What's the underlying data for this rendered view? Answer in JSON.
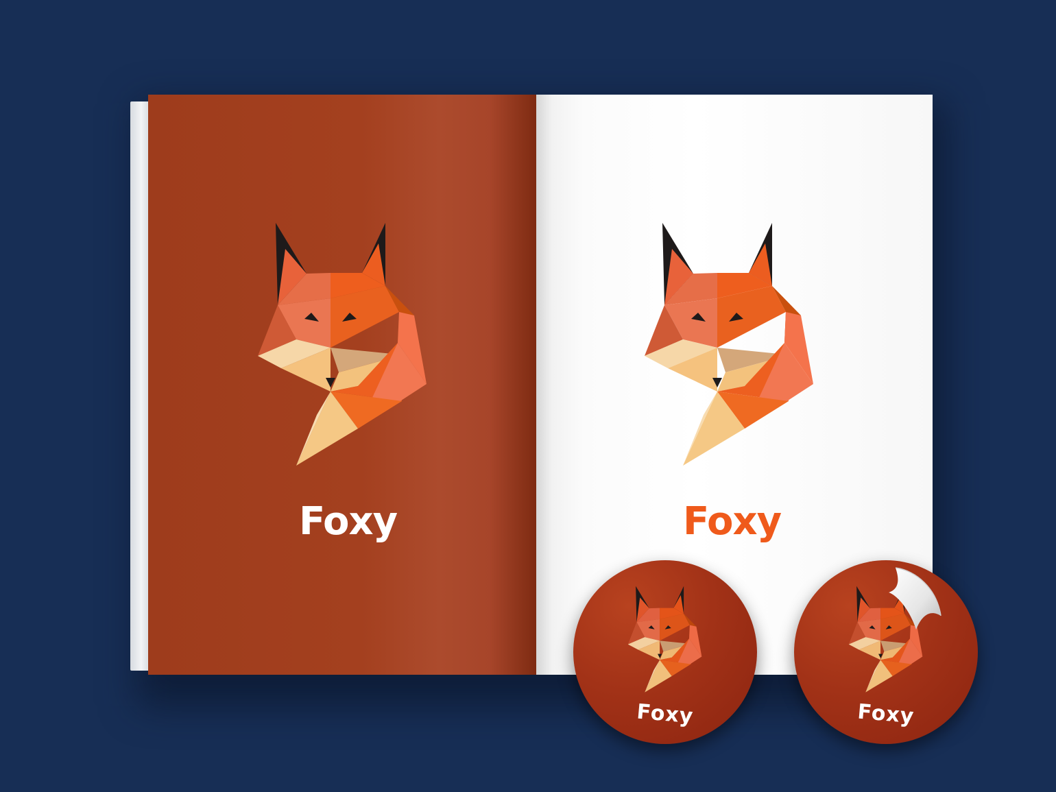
{
  "brand": {
    "name": "Foxy",
    "colors": {
      "background": "#172e55",
      "cover": "#a4401f",
      "accent": "#ef5a1b",
      "paper": "#ffffff"
    }
  },
  "book": {
    "left_page": {
      "wordmark": "Foxy",
      "logo": "fox-logo"
    },
    "right_page": {
      "wordmark": "Foxy",
      "logo": "fox-logo"
    }
  },
  "stickers": [
    {
      "wordmark": "Foxy",
      "logo": "fox-logo",
      "peeled": false
    },
    {
      "wordmark": "Foxy",
      "logo": "fox-logo",
      "peeled": true
    }
  ]
}
